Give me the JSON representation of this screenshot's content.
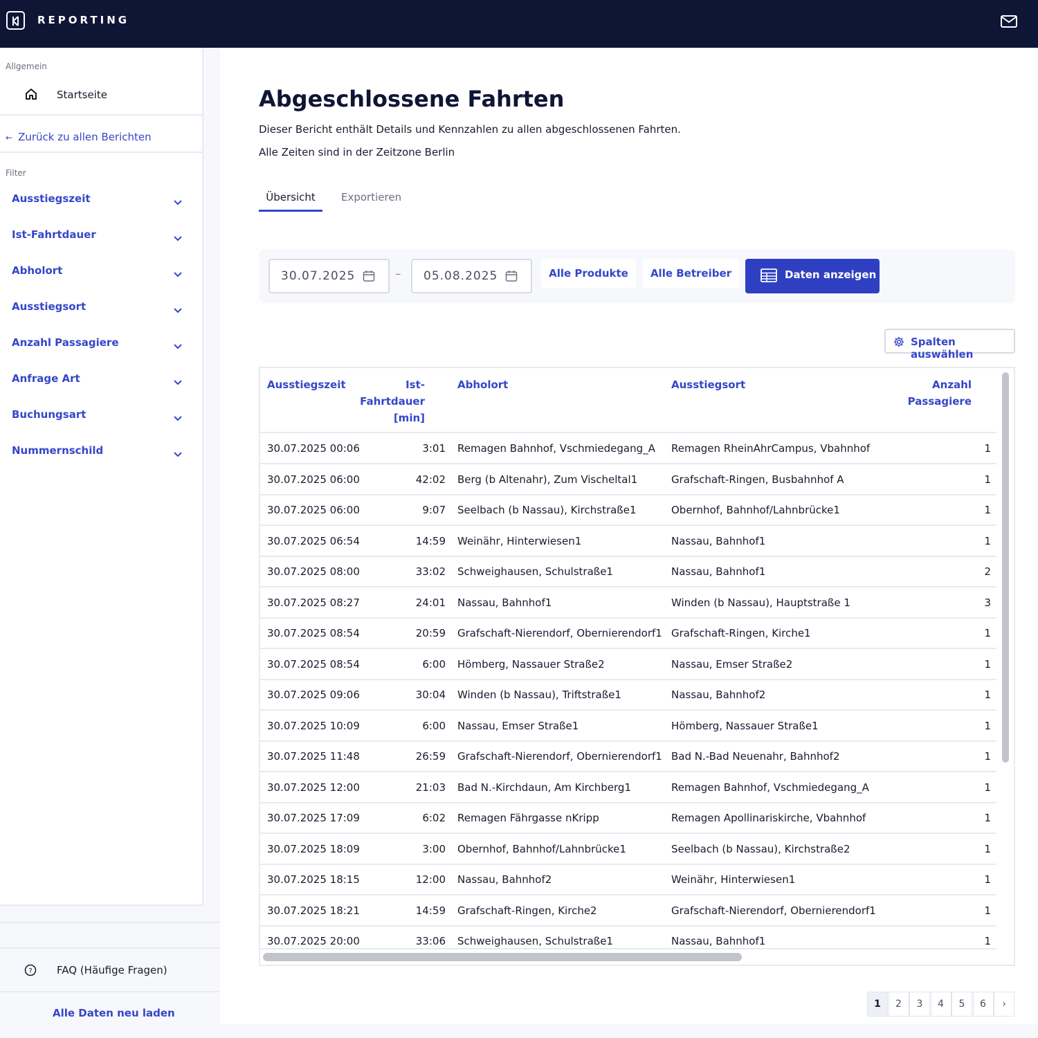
{
  "header": {
    "brand": "REPORTING",
    "colors": {
      "background": "#0f1535",
      "accent": "#2f3fc2"
    }
  },
  "sidebar": {
    "section_general": "Allgemein",
    "home_label": "Startseite",
    "back_label": "Zurück zu allen Berichten",
    "section_filter": "Filter",
    "filters": [
      {
        "label": "Ausstiegszeit"
      },
      {
        "label": "Ist-Fahrtdauer"
      },
      {
        "label": "Abholort"
      },
      {
        "label": "Ausstiegsort"
      },
      {
        "label": "Anzahl Passagiere"
      },
      {
        "label": "Anfrage Art"
      },
      {
        "label": "Buchungsart"
      },
      {
        "label": "Nummernschild"
      }
    ],
    "faq_label": "FAQ (Häufige Fragen)",
    "reload_label": "Alle Daten neu laden"
  },
  "main": {
    "title": "Abgeschlossene Fahrten",
    "description": "Dieser Bericht enthält Details und Kennzahlen zu allen abgeschlossenen Fahrten.",
    "timezone_note": "Alle Zeiten sind in der Zeitzone Berlin",
    "tabs": [
      {
        "label": "Übersicht",
        "active": true
      },
      {
        "label": "Exportieren",
        "active": false
      }
    ],
    "filter_bar": {
      "date_from": "30.07.2025",
      "date_to": "05.08.2025",
      "separator": "–",
      "products_label": "Alle Produkte",
      "operators_label": "Alle Betreiber",
      "show_data_label": "Daten anzeigen"
    },
    "select_columns_label": "Spalten auswählen"
  },
  "table": {
    "headers": {
      "time": "Ausstiegszeit",
      "duration_1": "Ist-",
      "duration_2": "Fahrtdauer",
      "duration_3": "[min]",
      "from": "Abholort",
      "to": "Ausstiegsort",
      "pax_1": "Anzahl",
      "pax_2": "Passagiere"
    },
    "rows": [
      {
        "time": "30.07.2025 00:06",
        "duration": "3:01",
        "from": "Remagen Bahnhof, Vschmiedegang_A",
        "to": "Remagen RheinAhrCampus, Vbahnhof",
        "pax": "1"
      },
      {
        "time": "30.07.2025 06:00",
        "duration": "42:02",
        "from": "Berg (b Altenahr), Zum Vischeltal1",
        "to": "Grafschaft-Ringen, Busbahnhof A",
        "pax": "1"
      },
      {
        "time": "30.07.2025 06:00",
        "duration": "9:07",
        "from": "Seelbach (b Nassau), Kirchstraße1",
        "to": "Obernhof, Bahnhof/Lahnbrücke1",
        "pax": "1"
      },
      {
        "time": "30.07.2025 06:54",
        "duration": "14:59",
        "from": "Weinähr, Hinterwiesen1",
        "to": "Nassau, Bahnhof1",
        "pax": "1"
      },
      {
        "time": "30.07.2025 08:00",
        "duration": "33:02",
        "from": "Schweighausen, Schulstraße1",
        "to": "Nassau, Bahnhof1",
        "pax": "2"
      },
      {
        "time": "30.07.2025 08:27",
        "duration": "24:01",
        "from": "Nassau, Bahnhof1",
        "to": "Winden (b Nassau), Hauptstraße 1",
        "pax": "3"
      },
      {
        "time": "30.07.2025 08:54",
        "duration": "20:59",
        "from": "Grafschaft-Nierendorf, Obernierendorf1",
        "to": "Grafschaft-Ringen, Kirche1",
        "pax": "1"
      },
      {
        "time": "30.07.2025 08:54",
        "duration": "6:00",
        "from": "Hömberg, Nassauer Straße2",
        "to": "Nassau, Emser Straße2",
        "pax": "1"
      },
      {
        "time": "30.07.2025 09:06",
        "duration": "30:04",
        "from": "Winden (b Nassau), Triftstraße1",
        "to": "Nassau, Bahnhof2",
        "pax": "1"
      },
      {
        "time": "30.07.2025 10:09",
        "duration": "6:00",
        "from": "Nassau, Emser Straße1",
        "to": "Hömberg, Nassauer Straße1",
        "pax": "1"
      },
      {
        "time": "30.07.2025 11:48",
        "duration": "26:59",
        "from": "Grafschaft-Nierendorf, Obernierendorf1",
        "to": "Bad N.-Bad Neuenahr, Bahnhof2",
        "pax": "1"
      },
      {
        "time": "30.07.2025 12:00",
        "duration": "21:03",
        "from": "Bad N.-Kirchdaun, Am Kirchberg1",
        "to": "Remagen Bahnhof, Vschmiedegang_A",
        "pax": "1"
      },
      {
        "time": "30.07.2025 17:09",
        "duration": "6:02",
        "from": "Remagen Fährgasse nKripp",
        "to": "Remagen Apollinariskirche, Vbahnhof",
        "pax": "1"
      },
      {
        "time": "30.07.2025 18:09",
        "duration": "3:00",
        "from": "Obernhof, Bahnhof/Lahnbrücke1",
        "to": "Seelbach (b Nassau), Kirchstraße2",
        "pax": "1"
      },
      {
        "time": "30.07.2025 18:15",
        "duration": "12:00",
        "from": "Nassau, Bahnhof2",
        "to": "Weinähr, Hinterwiesen1",
        "pax": "1"
      },
      {
        "time": "30.07.2025 18:21",
        "duration": "14:59",
        "from": "Grafschaft-Ringen, Kirche2",
        "to": "Grafschaft-Nierendorf, Obernierendorf1",
        "pax": "1"
      },
      {
        "time": "30.07.2025 20:00",
        "duration": "33:06",
        "from": "Schweighausen, Schulstraße1",
        "to": "Nassau, Bahnhof1",
        "pax": "1"
      }
    ]
  },
  "pagination": {
    "pages": [
      "1",
      "2",
      "3",
      "4",
      "5",
      "6"
    ],
    "current": "1",
    "next": "›"
  }
}
